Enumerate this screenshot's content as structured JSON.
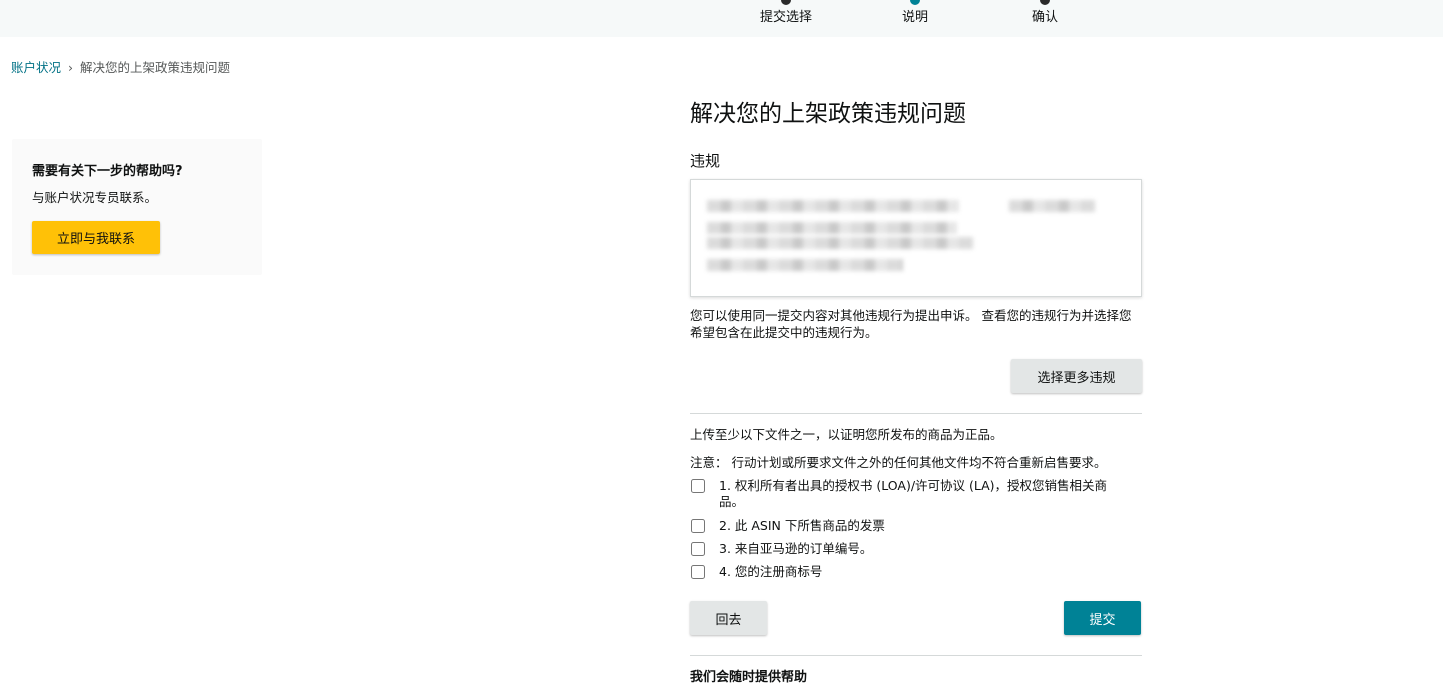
{
  "steps": [
    {
      "label": "提交选择",
      "state": "done"
    },
    {
      "label": "说明",
      "state": "current"
    },
    {
      "label": "确认",
      "state": "done"
    }
  ],
  "breadcrumb": {
    "link": "账户状况",
    "separator": "›",
    "current": "解决您的上架政策违规问题"
  },
  "help_card": {
    "title": "需要有关下一步的帮助吗?",
    "text": "与账户状况专员联系。",
    "button_label": "立即与我联系"
  },
  "main": {
    "title": "解决您的上架政策违规问题",
    "violation_label": "违规",
    "description": "您可以使用同一提交内容对其他违规行为提出申诉。 查看您的违规行为并选择您希望包含在此提交中的违规行为。",
    "more_button": "选择更多违规",
    "upload_text": "上传至少以下文件之一，以证明您所发布的商品为正品。",
    "note_text": "注意： 行动计划或所要求文件之外的任何其他文件均不符合重新启售要求。",
    "documents": [
      {
        "label": "1. 权利所有者出具的授权书 (LOA)/许可协议 (LA)，授权您销售相关商品。",
        "checked": false
      },
      {
        "label": "2. 此 ASIN 下所售商品的发票",
        "checked": false
      },
      {
        "label": "3. 来自亚马逊的订单编号。",
        "checked": false
      },
      {
        "label": "4. 您的注册商标号",
        "checked": false
      }
    ],
    "back_button": "回去",
    "submit_button": "提交",
    "help_heading": "我们会随时提供帮助"
  },
  "colors": {
    "accent_teal": "#008296",
    "button_yellow": "#ffc107",
    "link": "#007185"
  }
}
